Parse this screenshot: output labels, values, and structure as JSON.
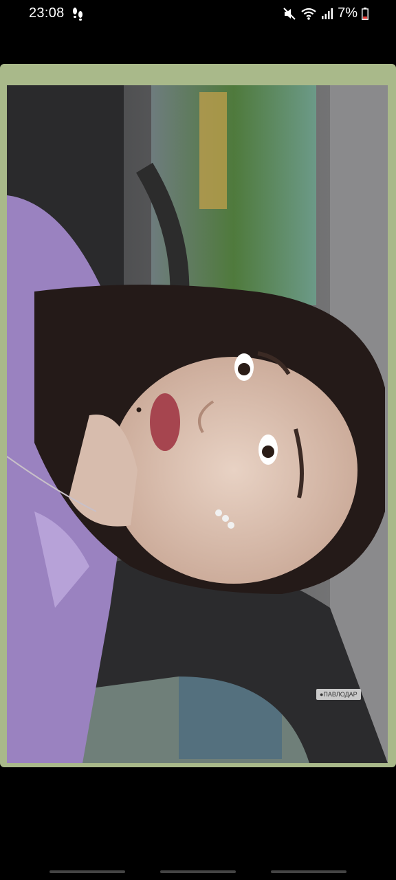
{
  "status_bar": {
    "time": "23:08",
    "battery_text": "7%",
    "icons": [
      "footsteps-icon",
      "mute-icon",
      "wifi-icon",
      "signal-icon",
      "battery-icon"
    ],
    "battery_color": "#e53935"
  },
  "photo": {
    "frame_color": "#a9b98a",
    "location_tag": "●ПАВЛОДАР"
  }
}
